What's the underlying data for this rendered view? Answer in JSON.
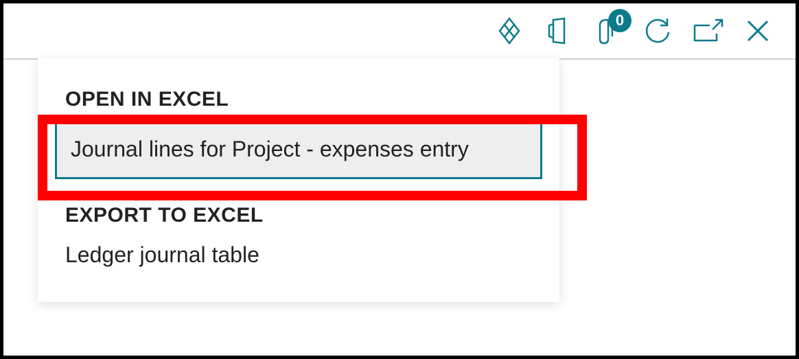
{
  "toolbar": {
    "attachments_badge": "0"
  },
  "dropdown": {
    "sections": [
      {
        "header": "OPEN IN EXCEL",
        "items": [
          {
            "label": "Journal lines for Project - expenses entry",
            "selected": true
          }
        ]
      },
      {
        "header": "EXPORT TO EXCEL",
        "items": [
          {
            "label": "Ledger journal table",
            "selected": false
          }
        ]
      }
    ]
  },
  "colors": {
    "accent": "#0b7b8c",
    "highlight": "#ff0000"
  }
}
